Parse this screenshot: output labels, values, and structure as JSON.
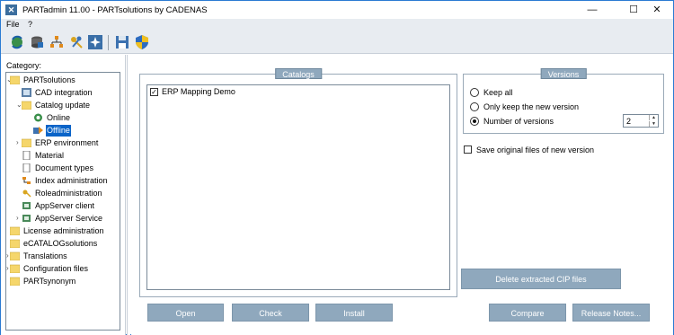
{
  "window": {
    "title": "PARTadmin 11.00 - PARTsolutions by CADENAS",
    "icon_glyph": "✕"
  },
  "window_controls": {
    "minimize": "—",
    "maximize": "☐",
    "close": "✕"
  },
  "menu": {
    "file": "File",
    "help": "?"
  },
  "toolbar": {
    "icons": [
      "refresh-globe-icon",
      "database-icon",
      "hierarchy-icon",
      "keys-icon",
      "gear-star-icon",
      "save-icon",
      "shield-icon"
    ]
  },
  "sidebar": {
    "category_label": "Category:",
    "tree": [
      {
        "label": "PARTsolutions",
        "level": 0,
        "icon": "folder",
        "expander": "⌄"
      },
      {
        "label": "CAD integration",
        "level": 1,
        "icon": "cad"
      },
      {
        "label": "Catalog update",
        "level": 1,
        "icon": "folder",
        "expander": "⌄"
      },
      {
        "label": "Online",
        "level": 2,
        "icon": "online"
      },
      {
        "label": "Offline",
        "level": 2,
        "icon": "offline",
        "selected": true
      },
      {
        "label": "ERP environment",
        "level": 1,
        "icon": "folder",
        "expander": "›"
      },
      {
        "label": "Material",
        "level": 1,
        "icon": "doc"
      },
      {
        "label": "Document types",
        "level": 1,
        "icon": "doc"
      },
      {
        "label": "Index administration",
        "level": 1,
        "icon": "index"
      },
      {
        "label": "Roleadministration",
        "level": 1,
        "icon": "role"
      },
      {
        "label": "AppServer client",
        "level": 1,
        "icon": "app"
      },
      {
        "label": "AppServer Service",
        "level": 1,
        "icon": "app",
        "expander": "›"
      },
      {
        "label": "License administration",
        "level": 0,
        "icon": "folder"
      },
      {
        "label": "eCATALOGsolutions",
        "level": 0,
        "icon": "folder"
      },
      {
        "label": "Translations",
        "level": 0,
        "icon": "folder",
        "expander": "›"
      },
      {
        "label": "Configuration files",
        "level": 0,
        "icon": "folder",
        "expander": "›"
      },
      {
        "label": "PARTsynonym",
        "level": 0,
        "icon": "folder"
      }
    ]
  },
  "catalogs": {
    "title": "Catalogs",
    "items": [
      {
        "label": "ERP Mapping Demo",
        "checked": true,
        "check_glyph": "✓"
      }
    ]
  },
  "versions": {
    "title": "Versions",
    "options": [
      {
        "label": "Keep all",
        "selected": false
      },
      {
        "label": "Only keep the new version",
        "selected": false
      },
      {
        "label": "Number of versions",
        "selected": true
      }
    ],
    "number_of_versions": "2",
    "spin_up": "▲",
    "spin_down": "▼"
  },
  "save_original": {
    "label": "Save original files of new version",
    "checked": false
  },
  "buttons": {
    "delete_cip": "Delete extracted CIP files",
    "open": "Open",
    "check": "Check",
    "install": "Install",
    "compare": "Compare",
    "release_notes": "Release Notes..."
  },
  "colors": {
    "accent_button": "#8fa8bd",
    "selection": "#0a64c8",
    "folder": "#f5d66b",
    "toolbar_bg": "#e8ecf1"
  }
}
